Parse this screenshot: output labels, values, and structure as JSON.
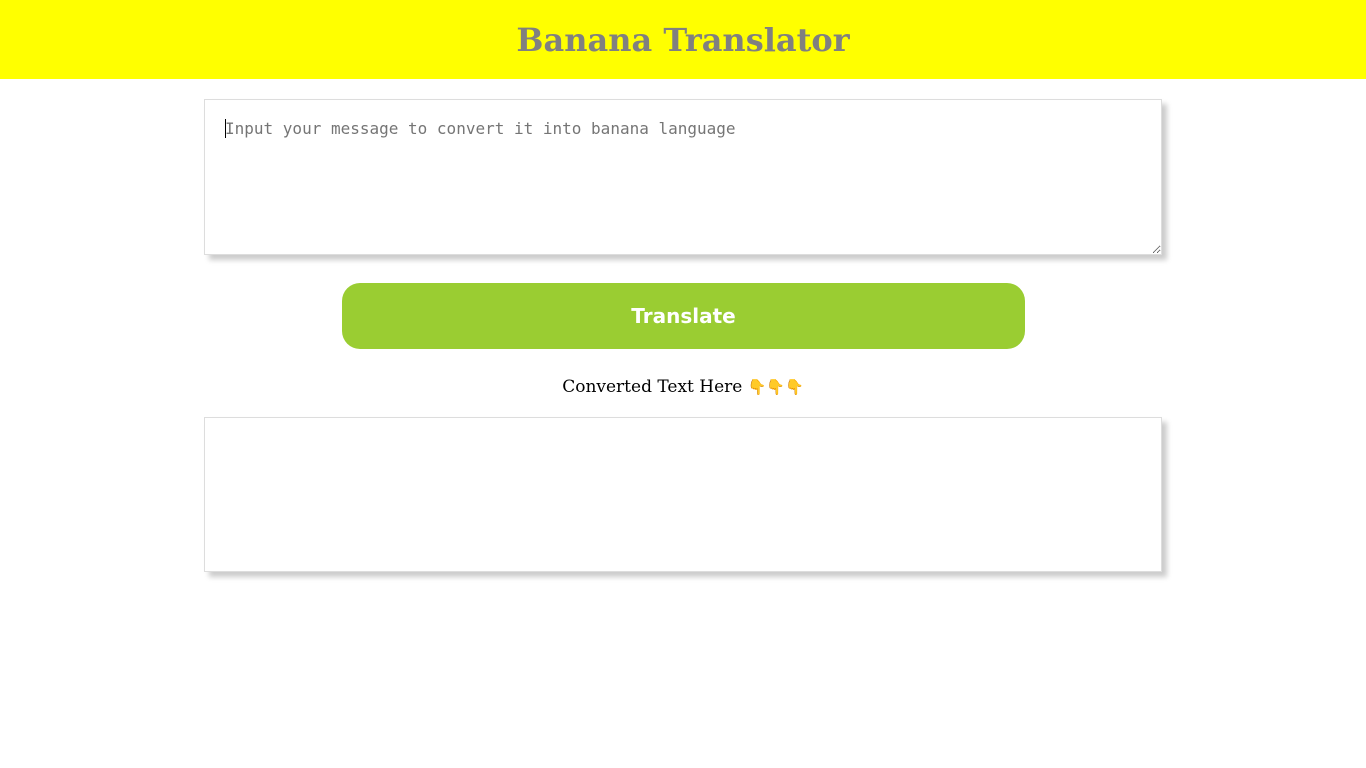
{
  "header": {
    "title": "Banana Translator",
    "background": "#ffff00",
    "title_color": "#808080"
  },
  "input": {
    "placeholder": "Input your message to convert it into banana language",
    "value": ""
  },
  "translate_button": {
    "label": "Translate",
    "color": "#9acd32"
  },
  "output": {
    "label": "Converted Text Here",
    "pointer_emojis": "👇👇👇",
    "text": ""
  }
}
